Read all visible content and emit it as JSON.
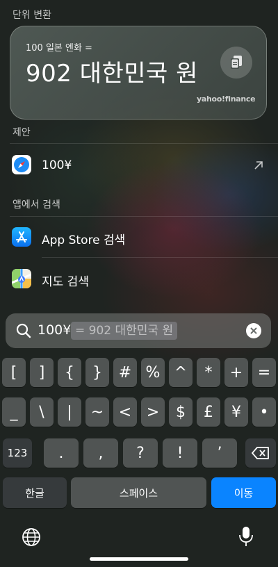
{
  "conversion": {
    "section_label": "단위 변환",
    "input_text": "100 일본 엔화 =",
    "result_text": "902 대한민국 원",
    "source": "yahoo!finance"
  },
  "suggestions": {
    "section_label": "제안",
    "item_label": "100¥"
  },
  "app_search": {
    "section_label": "앱에서 검색",
    "items": [
      {
        "label": "App Store 검색"
      },
      {
        "label": "지도 검색"
      }
    ]
  },
  "search": {
    "query": "100¥",
    "completion": "= 902 대한민국 원"
  },
  "keyboard": {
    "row1": [
      "[",
      "]",
      "{",
      "}",
      "#",
      "%",
      "^",
      "*",
      "+",
      "="
    ],
    "row2": [
      "_",
      "\\",
      "|",
      "~",
      "<",
      ">",
      "$",
      "£",
      "¥",
      "•"
    ],
    "row3": [
      ".",
      ",",
      "?",
      "!",
      "’"
    ],
    "mode_key": "123",
    "lang_key": "한글",
    "space_key": "스페이스",
    "go_key": "이동"
  },
  "colors": {
    "accent": "#0a84ff"
  }
}
